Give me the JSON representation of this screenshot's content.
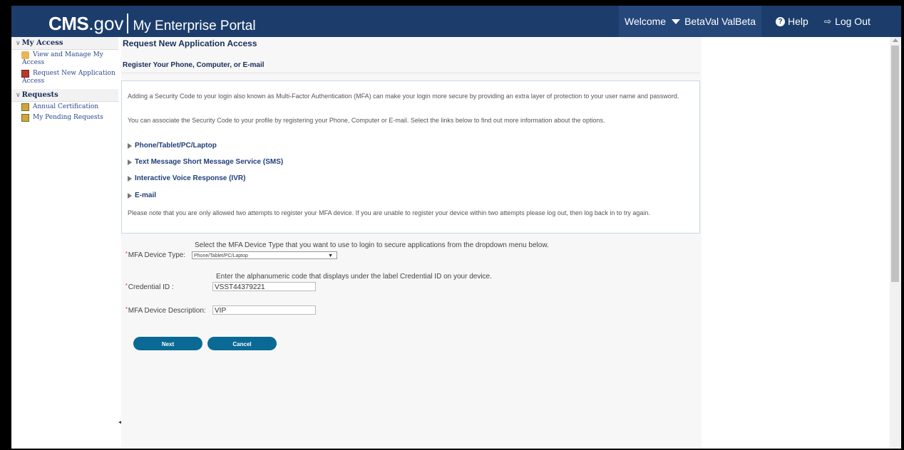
{
  "header": {
    "brand_cms": "CMS",
    "brand_gov": ".gov",
    "portal_title": "My Enterprise Portal",
    "welcome_label": "Welcome",
    "user_name": "BetaVal ValBeta",
    "help_label": "Help",
    "logout_label": "Log Out",
    "bar_color": "#1c3d6b"
  },
  "sidebar": {
    "sections": [
      {
        "title": "My Access",
        "items": [
          {
            "line1": "View and Manage My",
            "line2": "Access",
            "icon": "person-key-icon"
          },
          {
            "line1": "Request New Application",
            "line2": "Access",
            "icon": "book-icon"
          }
        ]
      },
      {
        "title": "Requests",
        "items": [
          {
            "line1": "Annual Certification",
            "icon": "certificate-icon"
          },
          {
            "line1": "My Pending Requests",
            "icon": "certificate-icon"
          }
        ]
      }
    ]
  },
  "main": {
    "page_title": "Request New Application Access",
    "section_title": "Register Your Phone, Computer, or E-mail",
    "info": {
      "para1": "Adding a Security Code to your login also known as Multi-Factor Authentication (MFA) can make your login more secure by providing an extra layer of protection to your user name and password.",
      "para2": "You can associate the Security Code to your profile by registering your Phone, Computer or E-mail. Select the links below to find out more information about the options.",
      "options": [
        "Phone/Tablet/PC/Laptop",
        "Text Message Short Message Service (SMS)",
        "Interactive Voice Response (IVR)",
        "E-mail"
      ],
      "note": "Please note that you are only allowed two attempts to register your MFA device. If you are unable to register your device within two attempts please log out, then log back in to try again."
    },
    "form": {
      "device_hint": "Select the MFA Device Type that you want to use to login to secure applications from the dropdown menu below.",
      "device_type_label": "MFA Device Type:",
      "device_type_value": "Phone/Tablet/PC/Laptop",
      "credential_hint": "Enter the alphanumeric code that displays under the label Credential ID on your device.",
      "credential_label": "Credential ID :",
      "credential_value": "VSST44379221",
      "description_label": "MFA Device Description:",
      "description_value": "VIP",
      "next_label": "Next",
      "cancel_label": "Cancel",
      "button_color": "#0a6a95"
    }
  }
}
